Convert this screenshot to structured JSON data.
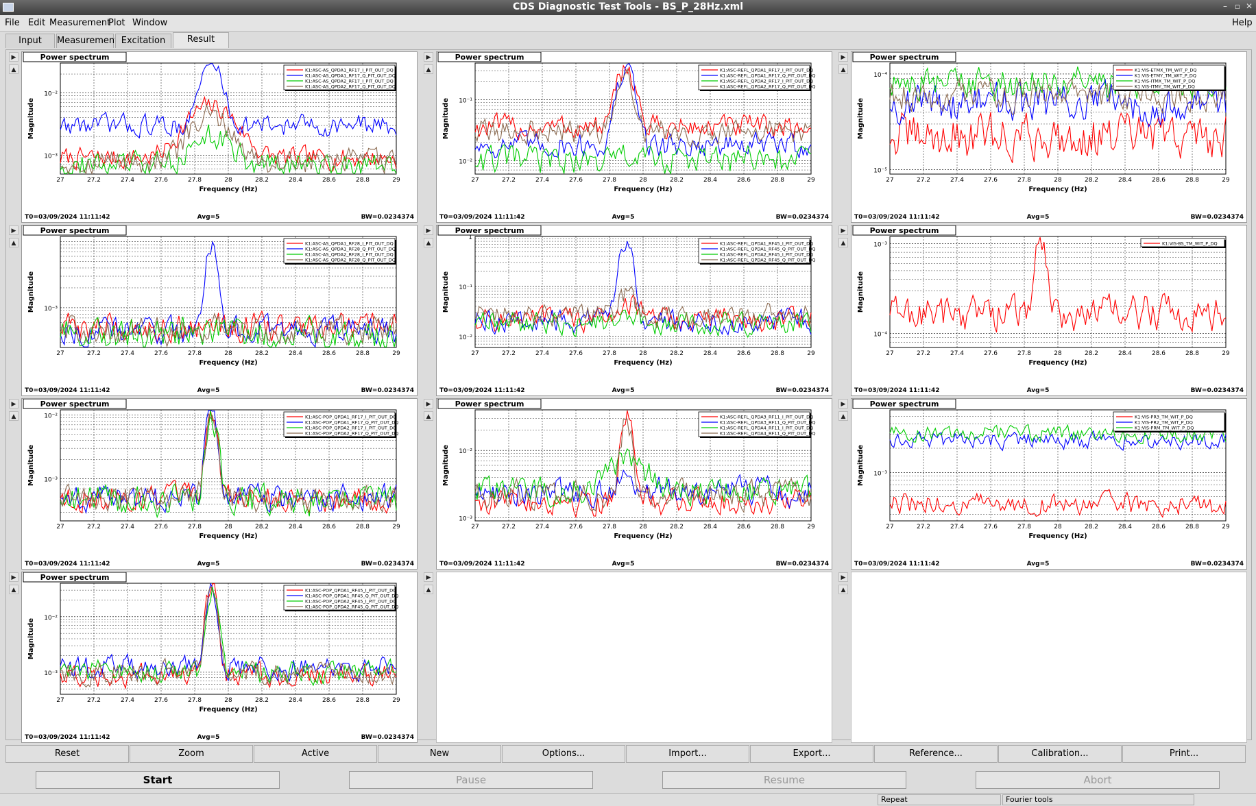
{
  "window": {
    "title": "CDS Diagnostic Test Tools - BS_P_28Hz.xml"
  },
  "menu": {
    "items": [
      "File",
      "Edit",
      "Measurement",
      "Plot",
      "Window"
    ],
    "help": "Help"
  },
  "tabs": [
    {
      "label": "Input",
      "active": false
    },
    {
      "label": "Measurement",
      "active": false
    },
    {
      "label": "Excitation",
      "active": false
    },
    {
      "label": "Result",
      "active": true
    }
  ],
  "plot_common": {
    "title": "Power spectrum",
    "xlabel": "Frequency (Hz)",
    "ylabel": "Magnitude",
    "t0": "T0=03/09/2024 11:11:42",
    "avg": "Avg=5",
    "bw": "BW=0.0234374",
    "xticks": [
      "27",
      "27.2",
      "27.4",
      "27.6",
      "27.8",
      "28",
      "28.2",
      "28.4",
      "28.6",
      "28.8",
      "29"
    ],
    "colors": {
      "red": "#ff0000",
      "blue": "#0000ff",
      "green": "#00cc00",
      "brown": "#8b6a50"
    }
  },
  "chart_data": [
    {
      "type": "line",
      "title": "Power spectrum",
      "xlabel": "Frequency (Hz)",
      "ylabel": "Magnitude",
      "xlim": [
        27,
        29
      ],
      "ylog": true,
      "ylim": [
        0.0005,
        0.03
      ],
      "yticks": [
        {
          "label": "10⁻²",
          "value": 0.01
        },
        {
          "label": "10⁻³",
          "value": 0.001
        }
      ],
      "peak": 27.9,
      "series": [
        {
          "name": "K1:ASC-AS_QPDA1_RF17_I_PIT_OUT_DQ",
          "color": "#ff0000",
          "base": 0.0009,
          "peak": 0.006,
          "width": 0.12,
          "noise": 0.25
        },
        {
          "name": "K1:ASC-AS_QPDA1_RF17_Q_PIT_OUT_DQ",
          "color": "#0000ff",
          "base": 0.003,
          "peak": 0.03,
          "width": 0.05,
          "noise": 0.25
        },
        {
          "name": "K1:ASC-AS_QPDA2_RF17_I_PIT_OUT_DQ",
          "color": "#00cc00",
          "base": 0.0007,
          "peak": 0.002,
          "width": 0.1,
          "noise": 0.3
        },
        {
          "name": "K1:ASC-AS_QPDA2_RF17_Q_PIT_OUT_DQ",
          "color": "#8b6a50",
          "base": 0.0008,
          "peak": 0.004,
          "width": 0.1,
          "noise": 0.3
        }
      ]
    },
    {
      "type": "line",
      "title": "Power spectrum",
      "xlabel": "Frequency (Hz)",
      "ylabel": "Magnitude",
      "xlim": [
        27,
        29
      ],
      "ylog": true,
      "ylim": [
        0.006,
        0.4
      ],
      "yticks": [
        {
          "label": "10⁻¹",
          "value": 0.1
        },
        {
          "label": "10⁻²",
          "value": 0.01
        }
      ],
      "peak": 27.9,
      "series": [
        {
          "name": "K1:ASC-REFL_QPDA1_RF17_I_PIT_OUT_DQ",
          "color": "#ff0000",
          "base": 0.035,
          "peak": 0.35,
          "width": 0.04,
          "noise": 0.3
        },
        {
          "name": "K1:ASC-REFL_QPDA1_RF17_Q_PIT_OUT_DQ",
          "color": "#0000ff",
          "base": 0.018,
          "peak": 0.3,
          "width": 0.04,
          "noise": 0.3
        },
        {
          "name": "K1:ASC-REFL_QPDA2_RF17_I_PIT_OUT_DQ",
          "color": "#00cc00",
          "base": 0.01,
          "peak": 0.012,
          "width": 0.04,
          "noise": 0.35
        },
        {
          "name": "K1:ASC-REFL_QPDA2_RF17_Q_PIT_OUT_DQ",
          "color": "#8b6a50",
          "base": 0.03,
          "peak": 0.25,
          "width": 0.04,
          "noise": 0.3
        }
      ]
    },
    {
      "type": "line",
      "title": "Power spectrum",
      "xlabel": "Frequency (Hz)",
      "ylabel": "Magnitude",
      "xlim": [
        27,
        29
      ],
      "ylog": true,
      "ylim": [
        9e-06,
        0.00013
      ],
      "yticks": [
        {
          "label": "10⁻⁴",
          "value": 0.0001
        },
        {
          "label": "10⁻⁵",
          "value": 1e-05
        }
      ],
      "peak": 27.9,
      "series": [
        {
          "name": "K1:VIS-ETMX_TM_WIT_P_DQ",
          "color": "#ff0000",
          "base": 2.2e-05,
          "peak": 2.2e-05,
          "width": 0.05,
          "noise": 0.35
        },
        {
          "name": "K1:VIS-ETMY_TM_WIT_P_DQ",
          "color": "#0000ff",
          "base": 5e-05,
          "peak": 5e-05,
          "width": 0.05,
          "noise": 0.3
        },
        {
          "name": "K1:VIS-ITMX_TM_WIT_P_DQ",
          "color": "#00cc00",
          "base": 8e-05,
          "peak": 8e-05,
          "width": 0.05,
          "noise": 0.25
        },
        {
          "name": "K1:VIS-ITMY_TM_WIT_P_DQ",
          "color": "#8b6a50",
          "base": 6e-05,
          "peak": 6e-05,
          "width": 0.05,
          "noise": 0.25
        }
      ]
    },
    {
      "type": "line",
      "title": "Power spectrum",
      "xlabel": "Frequency (Hz)",
      "ylabel": "Magnitude",
      "xlim": [
        27,
        29
      ],
      "ylog": true,
      "ylim": [
        0.00025,
        0.012
      ],
      "yticks": [
        {
          "label": "10⁻³",
          "value": 0.001
        }
      ],
      "peak": 27.9,
      "series": [
        {
          "name": "K1:ASC-AS_QPDA1_RF28_I_PIT_OUT_DQ",
          "color": "#ff0000",
          "base": 0.0005,
          "peak": 0.0006,
          "width": 0.04,
          "noise": 0.3
        },
        {
          "name": "K1:ASC-AS_QPDA1_RF28_Q_PIT_OUT_DQ",
          "color": "#0000ff",
          "base": 0.00045,
          "peak": 0.011,
          "width": 0.025,
          "noise": 0.3
        },
        {
          "name": "K1:ASC-AS_QPDA2_RF28_I_PIT_OUT_DQ",
          "color": "#00cc00",
          "base": 0.0004,
          "peak": 0.0004,
          "width": 0.04,
          "noise": 0.35
        },
        {
          "name": "K1:ASC-AS_QPDA2_RF28_Q_PIT_OUT_DQ",
          "color": "#8b6a50",
          "base": 0.00045,
          "peak": 0.0005,
          "width": 0.04,
          "noise": 0.3
        }
      ]
    },
    {
      "type": "line",
      "title": "Power spectrum",
      "xlabel": "Frequency (Hz)",
      "ylabel": "Magnitude",
      "xlim": [
        27,
        29
      ],
      "ylog": true,
      "ylim": [
        0.006,
        1
      ],
      "yticks": [
        {
          "label": "1",
          "value": 1
        },
        {
          "label": "10⁻¹",
          "value": 0.1
        },
        {
          "label": "10⁻²",
          "value": 0.01
        }
      ],
      "peak": 27.9,
      "series": [
        {
          "name": "K1:ASC-REFL_QPDA1_RF45_I_PIT_OUT_DQ",
          "color": "#ff0000",
          "base": 0.022,
          "peak": 0.05,
          "width": 0.05,
          "noise": 0.35
        },
        {
          "name": "K1:ASC-REFL_QPDA1_RF45_Q_PIT_OUT_DQ",
          "color": "#0000ff",
          "base": 0.02,
          "peak": 0.9,
          "width": 0.03,
          "noise": 0.35
        },
        {
          "name": "K1:ASC-REFL_QPDA2_RF45_I_PIT_OUT_DQ",
          "color": "#00cc00",
          "base": 0.018,
          "peak": 0.03,
          "width": 0.05,
          "noise": 0.35
        },
        {
          "name": "K1:ASC-REFL_QPDA2_RF45_Q_PIT_OUT_DQ",
          "color": "#8b6a50",
          "base": 0.025,
          "peak": 0.06,
          "width": 0.05,
          "noise": 0.35
        }
      ]
    },
    {
      "type": "line",
      "title": "Power spectrum",
      "xlabel": "Frequency (Hz)",
      "ylabel": "Magnitude",
      "xlim": [
        27,
        29
      ],
      "ylog": true,
      "ylim": [
        7e-05,
        0.0012
      ],
      "yticks": [
        {
          "label": "10⁻³",
          "value": 0.001
        },
        {
          "label": "10⁻⁴",
          "value": 0.0001
        }
      ],
      "peak": 27.9,
      "series": [
        {
          "name": "K1:VIS-BS_TM_WIT_P_DQ",
          "color": "#ff0000",
          "base": 0.00017,
          "peak": 0.0011,
          "width": 0.025,
          "noise": 0.3
        }
      ]
    },
    {
      "type": "line",
      "title": "Power spectrum",
      "xlabel": "Frequency (Hz)",
      "ylabel": "Magnitude",
      "xlim": [
        27,
        29
      ],
      "ylog": true,
      "ylim": [
        0.00022,
        0.012
      ],
      "yticks": [
        {
          "label": "10⁻²",
          "value": 0.01
        },
        {
          "label": "10⁻³",
          "value": 0.001
        }
      ],
      "peak": 27.9,
      "series": [
        {
          "name": "K1:ASC-POP_QPDA1_RF17_I_PIT_OUT_DQ",
          "color": "#ff0000",
          "base": 0.0005,
          "peak": 0.011,
          "width": 0.025,
          "noise": 0.3
        },
        {
          "name": "K1:ASC-POP_QPDA1_RF17_Q_PIT_OUT_DQ",
          "color": "#0000ff",
          "base": 0.0005,
          "peak": 0.011,
          "width": 0.025,
          "noise": 0.3
        },
        {
          "name": "K1:ASC-POP_QPDA2_RF17_I_PIT_OUT_DQ",
          "color": "#00cc00",
          "base": 0.00045,
          "peak": 0.01,
          "width": 0.025,
          "noise": 0.35
        },
        {
          "name": "K1:ASC-POP_QPDA2_RF17_Q_PIT_OUT_DQ",
          "color": "#8b6a50",
          "base": 0.0005,
          "peak": 0.01,
          "width": 0.025,
          "noise": 0.3
        }
      ]
    },
    {
      "type": "line",
      "title": "Power spectrum",
      "xlabel": "Frequency (Hz)",
      "ylabel": "Magnitude",
      "xlim": [
        27,
        29
      ],
      "ylog": true,
      "ylim": [
        0.0009,
        0.04
      ],
      "yticks": [
        {
          "label": "10⁻²",
          "value": 0.01
        },
        {
          "label": "10⁻³",
          "value": 0.001
        }
      ],
      "peak": 27.9,
      "series": [
        {
          "name": "K1:ASC-REFL_QPDA3_RF11_I_PIT_OUT_DQ",
          "color": "#ff0000",
          "base": 0.0018,
          "peak": 0.038,
          "width": 0.025,
          "noise": 0.3
        },
        {
          "name": "K1:ASC-REFL_QPDA3_RF11_Q_PIT_OUT_DQ",
          "color": "#0000ff",
          "base": 0.0025,
          "peak": 0.004,
          "width": 0.04,
          "noise": 0.3
        },
        {
          "name": "K1:ASC-REFL_QPDA4_RF11_I_PIT_OUT_DQ",
          "color": "#00cc00",
          "base": 0.0025,
          "peak": 0.006,
          "width": 0.12,
          "noise": 0.3
        },
        {
          "name": "K1:ASC-REFL_QPDA4_RF11_Q_PIT_OUT_DQ",
          "color": "#8b6a50",
          "base": 0.0022,
          "peak": 0.03,
          "width": 0.025,
          "noise": 0.3
        }
      ]
    },
    {
      "type": "line",
      "title": "Power spectrum",
      "xlabel": "Frequency (Hz)",
      "ylabel": "Magnitude",
      "xlim": [
        27,
        29
      ],
      "ylog": true,
      "ylim": [
        0.00025,
        0.006
      ],
      "yticks": [
        {
          "label": "10⁻³",
          "value": 0.001
        }
      ],
      "peak": 27.9,
      "series": [
        {
          "name": "K1:VIS-PR3_TM_WIT_P_DQ",
          "color": "#ff0000",
          "base": 0.0004,
          "peak": 0.0004,
          "width": 0.05,
          "noise": 0.2
        },
        {
          "name": "K1:VIS-PR2_TM_WIT_P_DQ",
          "color": "#0000ff",
          "base": 0.0025,
          "peak": 0.0025,
          "width": 0.05,
          "noise": 0.15
        },
        {
          "name": "K1:VIS-PRM_TM_WIT_P_DQ",
          "color": "#00cc00",
          "base": 0.003,
          "peak": 0.003,
          "width": 0.05,
          "noise": 0.15
        }
      ]
    },
    {
      "type": "line",
      "title": "Power spectrum",
      "xlabel": "Frequency (Hz)",
      "ylabel": "Magnitude",
      "xlim": [
        27,
        29
      ],
      "ylog": true,
      "ylim": [
        0.0004,
        0.04
      ],
      "yticks": [
        {
          "label": "10⁻²",
          "value": 0.01
        },
        {
          "label": "10⁻³",
          "value": 0.001
        }
      ],
      "peak": 27.9,
      "series": [
        {
          "name": "K1:ASC-POP_QPDA1_RF45_I_PIT_OUT_DQ",
          "color": "#ff0000",
          "base": 0.0009,
          "peak": 0.035,
          "width": 0.025,
          "noise": 0.3
        },
        {
          "name": "K1:ASC-POP_QPDA1_RF45_Q_PIT_OUT_DQ",
          "color": "#0000ff",
          "base": 0.0012,
          "peak": 0.035,
          "width": 0.025,
          "noise": 0.3
        },
        {
          "name": "K1:ASC-POP_QPDA2_RF45_I_PIT_OUT_DQ",
          "color": "#00cc00",
          "base": 0.001,
          "peak": 0.03,
          "width": 0.025,
          "noise": 0.3
        },
        {
          "name": "K1:ASC-POP_QPDA2_RF45_Q_PIT_OUT_DQ",
          "color": "#8b6a50",
          "base": 0.001,
          "peak": 0.03,
          "width": 0.025,
          "noise": 0.3
        }
      ]
    }
  ],
  "toolbar": [
    "Reset",
    "Zoom",
    "Active",
    "New",
    "Options...",
    "Import...",
    "Export...",
    "Reference...",
    "Calibration...",
    "Print..."
  ],
  "actions": [
    {
      "label": "Start",
      "enabled": true
    },
    {
      "label": "Pause",
      "enabled": false
    },
    {
      "label": "Resume",
      "enabled": false
    },
    {
      "label": "Abort",
      "enabled": false
    }
  ],
  "status": {
    "repeat": "Repeat",
    "fourier": "Fourier tools"
  }
}
